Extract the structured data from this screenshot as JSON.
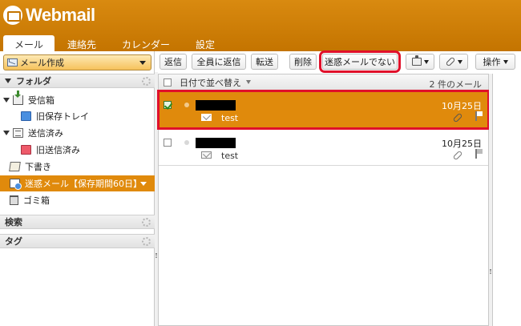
{
  "app": {
    "logo_text": "Webmail"
  },
  "nav_tabs": [
    {
      "label": "メール"
    },
    {
      "label": "連絡先"
    },
    {
      "label": "カレンダー"
    },
    {
      "label": "設定"
    }
  ],
  "sidebar": {
    "compose_label": "メール作成",
    "folder_section_title": "フォルダ",
    "folders": [
      {
        "label": "受信箱"
      },
      {
        "label": "旧保存トレイ"
      },
      {
        "label": "送信済み"
      },
      {
        "label": "旧送信済み"
      },
      {
        "label": "下書き"
      },
      {
        "label": "迷惑メール【保存期間60日】"
      },
      {
        "label": "ゴミ箱"
      }
    ],
    "search_section_title": "検索",
    "tag_section_title": "タグ"
  },
  "toolbar": {
    "reply": "返信",
    "reply_all": "全員に返信",
    "forward": "転送",
    "delete": "削除",
    "not_spam": "迷惑メールでない",
    "actions": "操作"
  },
  "list": {
    "sort_label": "日付で並べ替え",
    "count_label": "2 件のメール",
    "messages": [
      {
        "date": "10月25日",
        "subject": "test",
        "selected": true
      },
      {
        "date": "10月25日",
        "subject": "test",
        "selected": false
      }
    ]
  },
  "colors": {
    "header": "#d1820a",
    "selection": "#e08a0c",
    "highlight_outline": "#e0102a"
  }
}
